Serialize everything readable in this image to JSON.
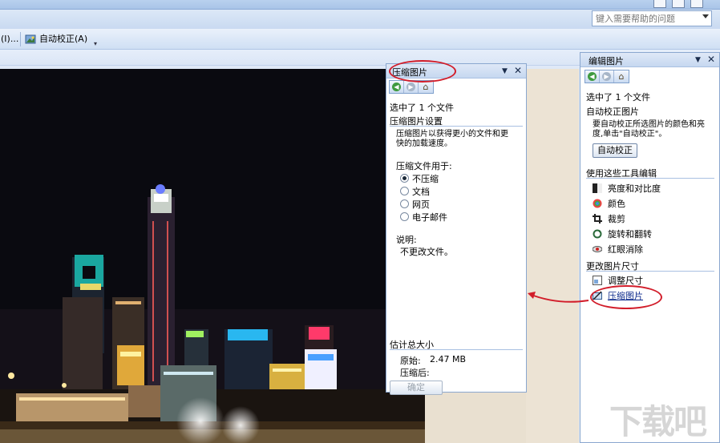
{
  "help": {
    "placeholder": "键入需要帮助的问题"
  },
  "toolbar": {
    "partial_item": "(I)...",
    "autocorrect_label": "自动校正(A)"
  },
  "compress_pane": {
    "title": "压缩图片",
    "selected": "选中了 1 个文件",
    "settings_header": "压缩图片设置",
    "settings_desc_line1": "压缩图片以获得更小的文件和更",
    "settings_desc_line2": "快的加载速度。",
    "compress_for": "压缩文件用于:",
    "options": [
      "不压缩",
      "文档",
      "网页",
      "电子邮件"
    ],
    "selected_option": "不压缩",
    "note_label": "说明:",
    "note_text": "不更改文件。",
    "size_header": "估计总大小",
    "original_label": "原始:",
    "original_value": "2.47 MB",
    "compressed_label": "压缩后:",
    "ok_button": "确定"
  },
  "edit_pane": {
    "title": "编辑图片",
    "selected": "选中了 1 个文件",
    "autocorrect_header": "自动校正图片",
    "autocorrect_desc_line1": "要自动校正所选图片的颜色和亮",
    "autocorrect_desc_line2": "度,单击\"自动校正\"。",
    "autocorrect_button": "自动校正",
    "tools_header": "使用这些工具编辑",
    "tools": [
      "亮度和对比度",
      "颜色",
      "裁剪",
      "旋转和翻转",
      "红眼消除"
    ],
    "resize_header": "更改图片尺寸",
    "resize_items": [
      "调整尺寸",
      "压缩图片"
    ]
  },
  "watermark": "下载吧",
  "colors": {
    "annotation_red": "#d21d2a",
    "pane_border": "#8aa7cf",
    "link": "#0c2a8c"
  }
}
